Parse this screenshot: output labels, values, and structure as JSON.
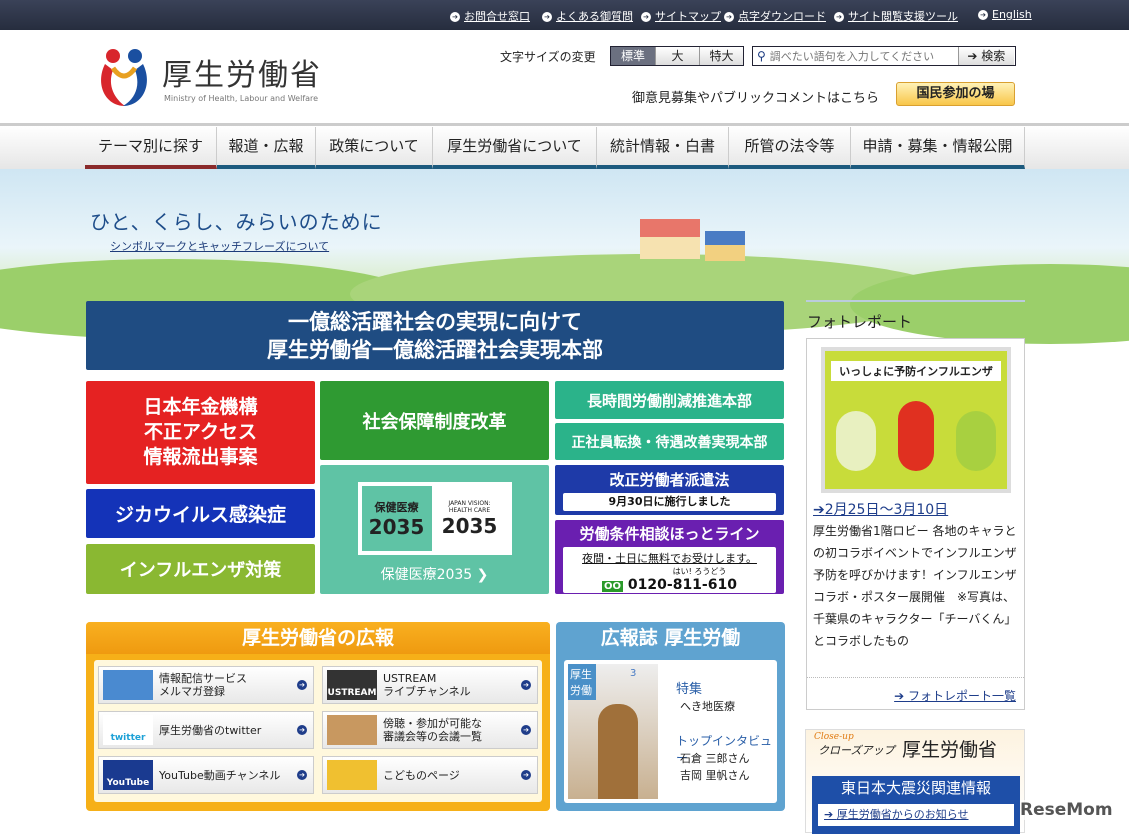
{
  "top_links": [
    "お問合せ窓口",
    "よくある御質問",
    "サイトマップ",
    "点字ダウンロード",
    "サイト閲覧支援ツール",
    "English"
  ],
  "logo": {
    "name": "厚生労働省",
    "sub": "Ministry of Health, Labour and Welfare"
  },
  "font_size": {
    "label": "文字サイズの変更",
    "options": [
      "標準",
      "大",
      "特大"
    ],
    "selected": "標準"
  },
  "search": {
    "placeholder": "調べたい語句を入力してください",
    "button": "検索"
  },
  "public_comment": {
    "text": "御意見募集やパブリックコメントはこちら",
    "button": "国民参加の場"
  },
  "nav": [
    "テーマ別に探す",
    "報道・広報",
    "政策について",
    "厚生労働省について",
    "統計情報・白書",
    "所管の法令等",
    "申請・募集・情報公開"
  ],
  "hero": {
    "catch": "ひと、くらし、みらいのために",
    "link": "シンボルマークとキャッチフレーズについて"
  },
  "banners": {
    "ichioku": [
      "一億総活躍社会の実現に向けて",
      "厚生労働省一億総活躍社会実現本部"
    ],
    "nenkin": [
      "日本年金機構",
      "不正アクセス",
      "情報流出事案"
    ],
    "shakai": "社会保障制度改革",
    "choujikan": "長時間労働削減推進本部",
    "seishain": "正社員転換・待遇改善実現本部",
    "zika": "ジカウイルス感染症",
    "influenza": "インフルエンザ対策",
    "hoken": {
      "logo_jp": "保健医療",
      "logo_year": "2035",
      "logo_en1": "JAPAN VISION:",
      "logo_en2": "HEALTH CARE",
      "label": "保健医療2035"
    },
    "haken": {
      "title": "改正労働者派遣法",
      "sub": "9月30日に施行しました"
    },
    "hotline": {
      "title": "労働条件相談ほっとライン",
      "sub": "夜間・土日に無料でお受けします。",
      "ruby": "はい! ろうどう",
      "phone": "0120-811-610"
    }
  },
  "kouhou": {
    "title": "厚生労働省の広報",
    "items": [
      {
        "label": "情報配信サービス\nメルマガ登録",
        "thumb": "mail-icon"
      },
      {
        "label": "USTREAM\nライブチャンネル",
        "thumb": "USTREAM"
      },
      {
        "label": "厚生労働省のtwitter",
        "thumb": "twitter"
      },
      {
        "label": "傍聴・参加が可能な\n審議会等の会議一覧",
        "thumb": "meeting-icon"
      },
      {
        "label": "YouTube動画チャンネル",
        "thumb": "YouTube"
      },
      {
        "label": "こどものページ",
        "thumb": "kids-icon"
      }
    ]
  },
  "magazine": {
    "title": "広報誌 厚生労働",
    "cover_title": "厚生労働",
    "issue": "3",
    "feature_head": "特集",
    "feature": "へき地医療",
    "interview_head": "トップインタビュー",
    "people": [
      "石倉 三郎さん",
      "吉岡 里帆さん"
    ]
  },
  "photo_report": {
    "title": "フォトレポート",
    "poster_title": "いっしょに予防インフルエンザ",
    "date": "2月25日～3月10日",
    "text": "厚生労働省1階ロビー 各地のキャラとの初コラボイベントでインフルエンザ予防を呼びかけます！インフルエンザ コラボ・ポスター展開催　※写真は、千葉県のキャラクター「チーバくん」とコラボしたもの",
    "list_link": "フォトレポート一覧"
  },
  "closeup": {
    "en": "Close-up",
    "jp": "クローズアップ",
    "title": "厚生労働省",
    "earthquake": "東日本大震災関連情報",
    "notice": "厚生労働省からのお知らせ"
  },
  "watermark": "ReseMom"
}
